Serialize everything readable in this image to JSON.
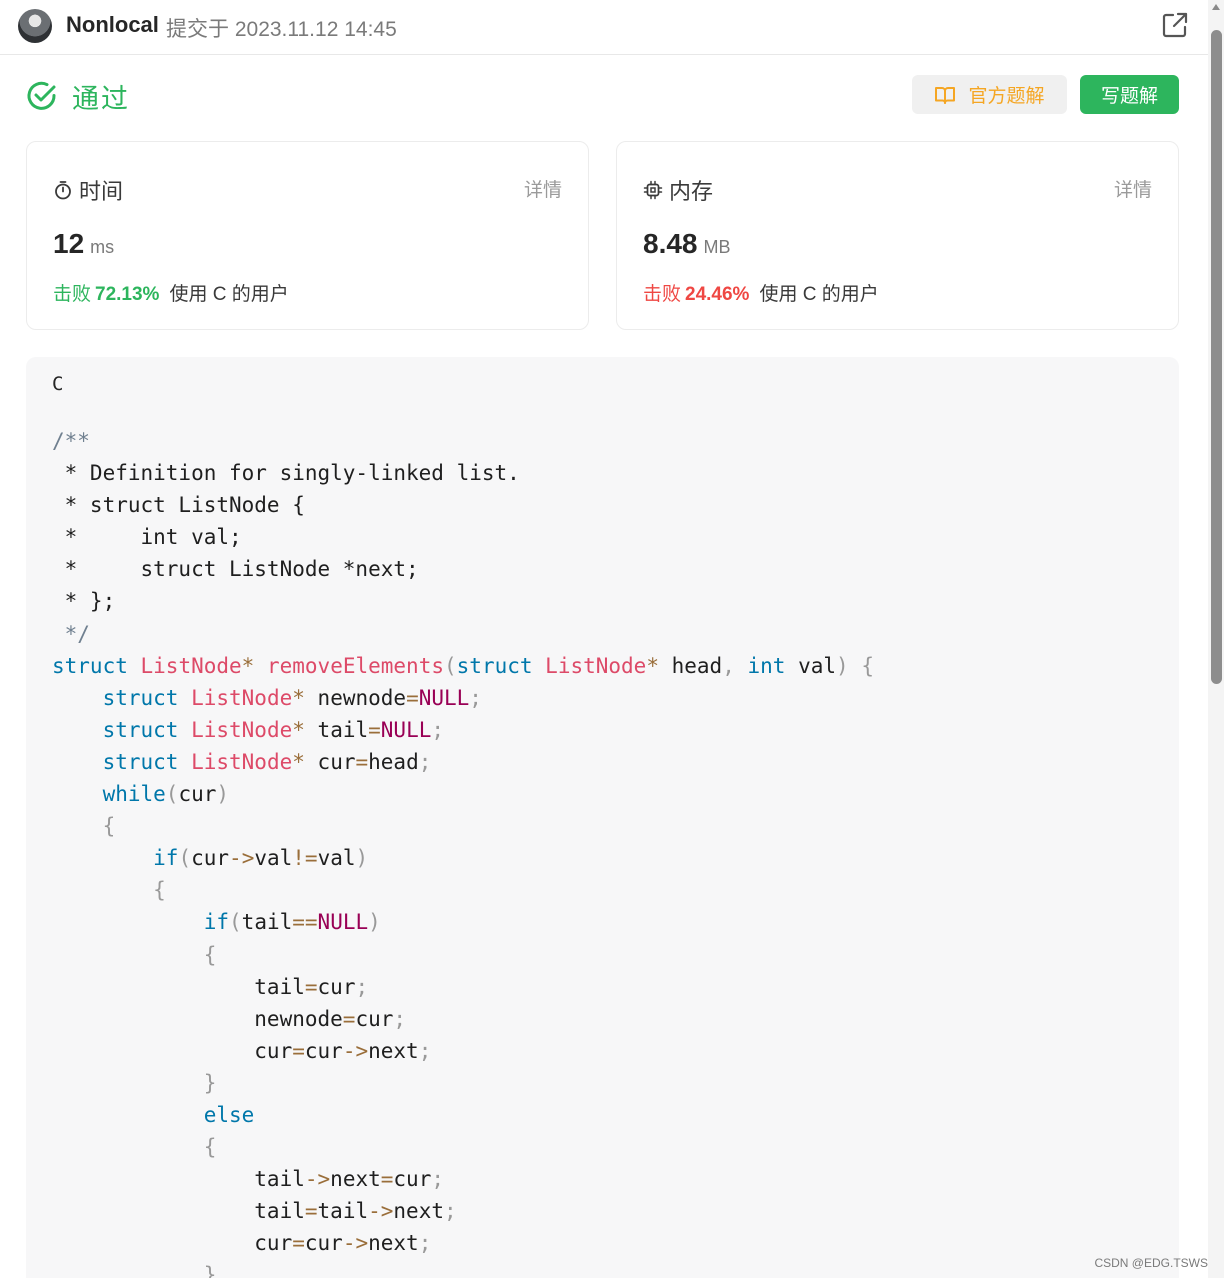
{
  "header": {
    "username": "Nonlocal",
    "submitted_text": "提交于 2023.11.12 14:45"
  },
  "status": {
    "label": "通过",
    "color": "#2db55d"
  },
  "buttons": {
    "official_solution": "官方题解",
    "write_solution": "写题解"
  },
  "runtime_card": {
    "title": "时间",
    "detail": "详情",
    "value": "12",
    "unit": "ms",
    "beat_prefix": "击败",
    "beat_percent": "72.13%",
    "beat_suffix": "使用 C 的用户"
  },
  "memory_card": {
    "title": "内存",
    "detail": "详情",
    "value": "8.48",
    "unit": "MB",
    "beat_prefix": "击败",
    "beat_percent": "24.46%",
    "beat_suffix": "使用 C 的用户"
  },
  "code": {
    "language": "C",
    "lines": [
      "/**",
      " * Definition for singly-linked list.",
      " * struct ListNode {",
      " *     int val;",
      " *     struct ListNode *next;",
      " * };",
      " */",
      "struct ListNode* removeElements(struct ListNode* head, int val) {",
      "    struct ListNode* newnode=NULL;",
      "    struct ListNode* tail=NULL;",
      "    struct ListNode* cur=head;",
      "    while(cur)",
      "    {",
      "        if(cur->val!=val)",
      "        {",
      "            if(tail==NULL)",
      "            {",
      "                tail=cur;",
      "                newnode=cur;",
      "                cur=cur->next;",
      "            }",
      "            else",
      "            {",
      "                tail->next=cur;",
      "                tail=tail->next;",
      "                cur=cur->next;",
      "            }"
    ]
  },
  "watermark": "CSDN @EDG.TSWS",
  "colors": {
    "accent_green": "#2db55d",
    "orange": "#f5a623",
    "red": "#ef4743"
  }
}
